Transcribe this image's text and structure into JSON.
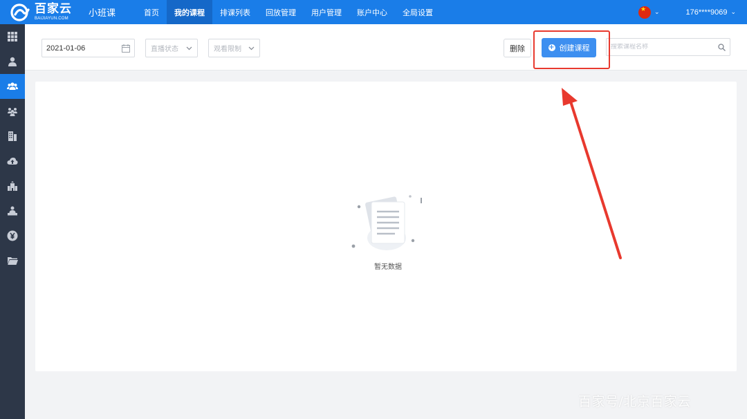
{
  "app": {
    "logo_main": "百家云",
    "logo_sub": "BAIJIAYUN.COM",
    "product": "小班课"
  },
  "nav": [
    {
      "label": "首页",
      "active": false
    },
    {
      "label": "我的课程",
      "active": true
    },
    {
      "label": "排课列表",
      "active": false
    },
    {
      "label": "回放管理",
      "active": false
    },
    {
      "label": "用户管理",
      "active": false
    },
    {
      "label": "账户中心",
      "active": false
    },
    {
      "label": "全局设置",
      "active": false
    }
  ],
  "header_right": {
    "language_icon": "china-flag-icon",
    "user": "176****9069"
  },
  "sidebar": {
    "icons": [
      "grid-icon",
      "user-icon",
      "group-icon",
      "team-icon",
      "building-icon",
      "cloud-upload-icon",
      "school-icon",
      "teacher-icon",
      "yen-icon",
      "folder-icon"
    ],
    "active_index": 2
  },
  "filters": {
    "date": "2021-01-06",
    "live_status_placeholder": "直播状态",
    "view_limit_placeholder": "观看限制",
    "search_placeholder": "搜索课程名称"
  },
  "actions": {
    "delete_label": "删除",
    "create_label": "创建课程"
  },
  "empty": {
    "text": "暂无数据"
  },
  "watermark": "百家号/北京百家云",
  "colors": {
    "topbar": "#1a7de8",
    "sidebar": "#2d3748",
    "primary_button": "#3d8ff0",
    "annotation": "#e8392e"
  }
}
